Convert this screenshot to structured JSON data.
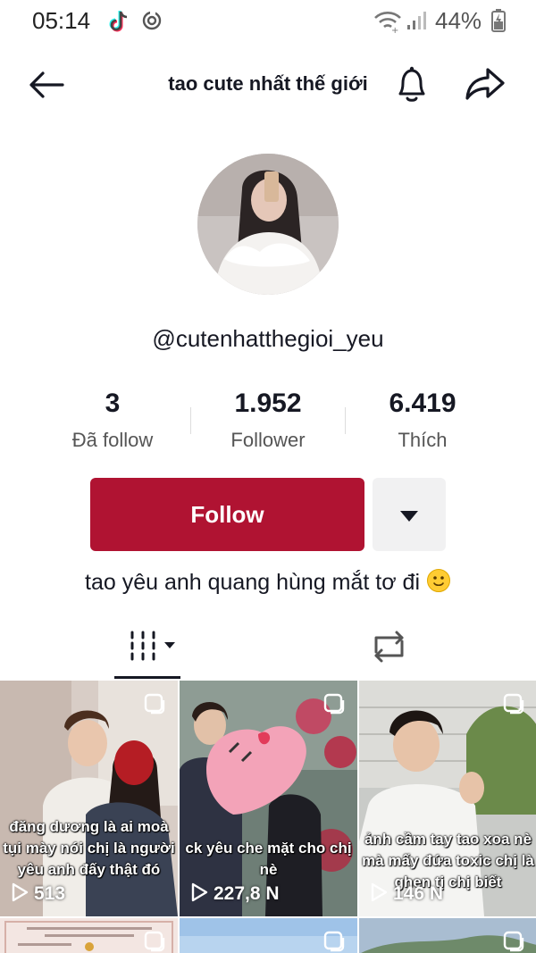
{
  "status_bar": {
    "time": "05:14",
    "battery": "44%"
  },
  "header": {
    "title": "tao cute nhất thế giới"
  },
  "profile": {
    "username": "@cutenhatthegioi_yeu",
    "bio": "tao yêu anh quang hùng mắt tơ đi",
    "stats": [
      {
        "value": "3",
        "label": "Đã follow"
      },
      {
        "value": "1.952",
        "label": "Follower"
      },
      {
        "value": "6.419",
        "label": "Thích"
      }
    ],
    "follow_label": "Follow"
  },
  "videos": [
    {
      "caption": "đăng dương là ai moà tụi mày nói chị là người yêu anh đấy thật đó",
      "views": "513"
    },
    {
      "caption": "ck yêu che mặt cho chị nè",
      "views": "227,8 N"
    },
    {
      "caption": "ảnh cầm tay tao xoa nè mà mấy đứa toxic chị là ghen tị chị biết",
      "views": "146 N"
    }
  ],
  "colors": {
    "follow": "#b01332",
    "text": "#161823"
  }
}
